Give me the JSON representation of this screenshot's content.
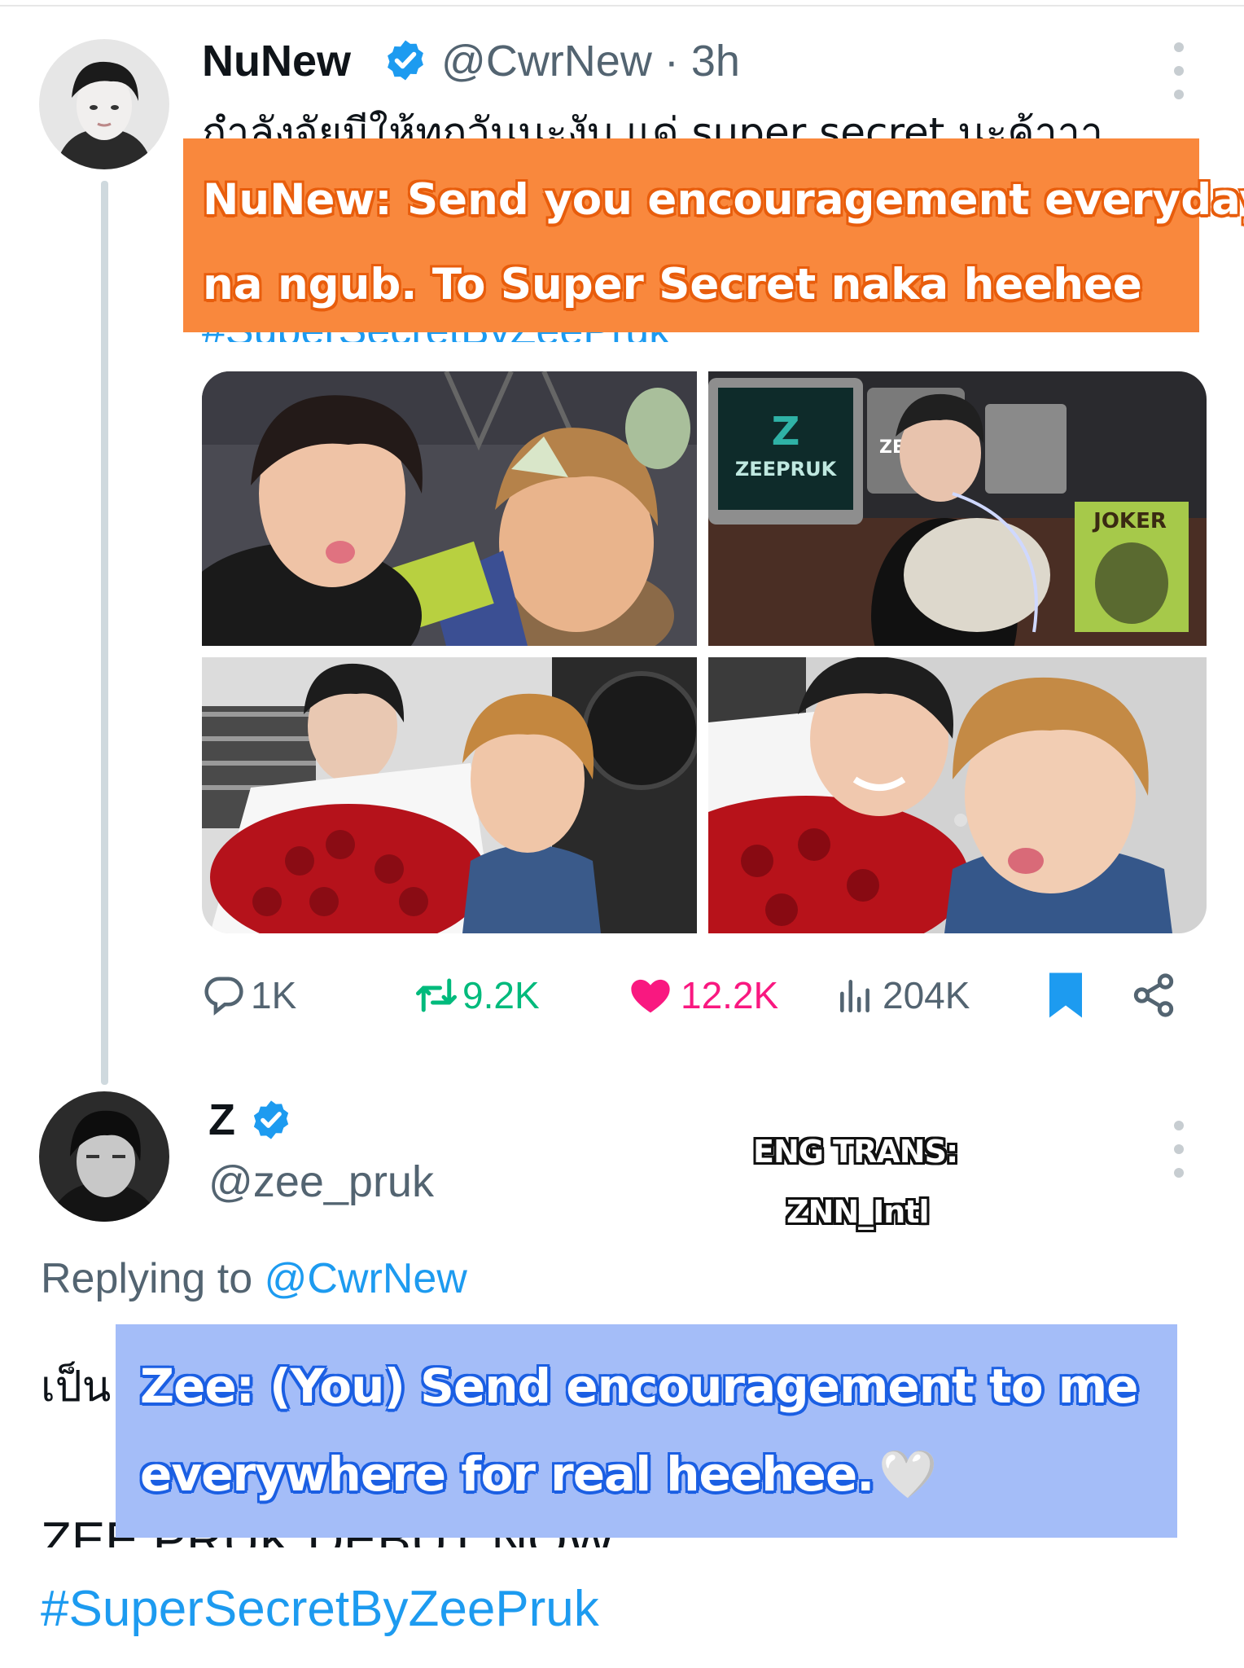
{
  "tweet": {
    "display_name": "NuNew",
    "handle": "@CwrNew",
    "separator": "·",
    "time": "3h",
    "thai_text": "กำลังจัยมีให้ทุกวันนะงับ แด่ super secret นะค้าาา",
    "hashtag": "#SuperSecretByZeePruk",
    "translation": {
      "line1": "NuNew: Send you encouragement everyday",
      "line2": "na ngub. To Super Secret naka heehee"
    },
    "photo_texts": {
      "brand": "ZEEPRUK",
      "screen": "ZEE",
      "box": "JOKER"
    },
    "stats": {
      "replies": "1K",
      "reposts": "9.2K",
      "likes": "12.2K",
      "views": "204K"
    },
    "colors": {
      "repost": "#00ba7c",
      "like": "#f91880",
      "bookmark": "#1d9bf0"
    }
  },
  "reply": {
    "display_name": "Z",
    "handle": "@zee_pruk",
    "replying_label": "Replying to",
    "replying_handle": "@CwrNew",
    "thai_start": "เป็น",
    "debut_text": "ZEE PRUK DEBUT NOW",
    "hashtag": "#SuperSecretByZeePruk",
    "translation": {
      "line1": "Zee: (You) Send encouragement to me",
      "line2": "everywhere for real heehee.",
      "heart": "🤍"
    }
  },
  "credit": {
    "line1": "ENG TRANS:",
    "line2": "ZNN_Intl"
  },
  "icons": [
    "verified-badge-icon",
    "more-options-icon",
    "reply-icon",
    "repost-icon",
    "like-icon",
    "views-icon",
    "bookmark-icon",
    "share-icon"
  ]
}
